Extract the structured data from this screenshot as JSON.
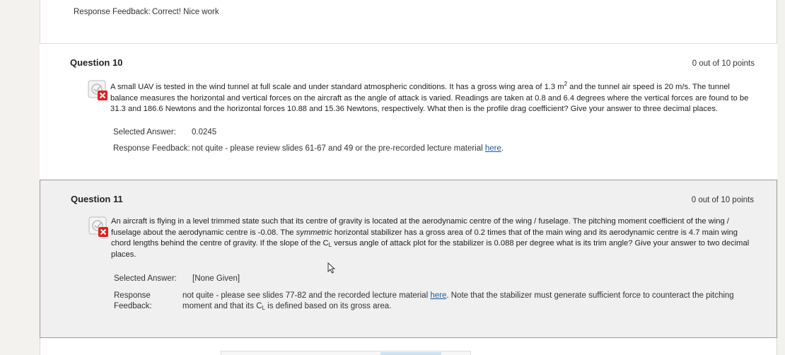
{
  "previous": {
    "feedback_label": "Response Feedback:",
    "feedback_value": "Correct! Nice work"
  },
  "q10": {
    "title": "Question 10",
    "points": "0 out of 10 points",
    "status_icon": "incorrect-icon",
    "text_part1": "A small UAV is tested in the wind tunnel at full scale and under standard atmospheric conditions. It has a gross wing area of 1.3 m",
    "text_sup": "2",
    "text_part2": " and the tunnel air speed is 20 m/s. The tunnel balance measures the horizontal and vertical forces on the aircraft as the angle of attack is varied. Readings are taken at 0.8 and 6.4 degrees where the vertical forces are found to be 31.3 and 186.6 Newtons and the horizontal forces 10.88 and 15.36 Newtons, respectively. What then is the profile drag coefficient? Give your answer to three decimal places.",
    "selected_label": "Selected Answer:",
    "selected_value": "0.0245",
    "feedback_label": "Response Feedback:",
    "feedback_text": "not quite - please review slides 61-67 and 49 or the pre-recorded lecture material ",
    "feedback_link": "here",
    "feedback_end": "."
  },
  "q11": {
    "title": "Question 11",
    "points": "0 out of 10 points",
    "status_icon": "incorrect-icon",
    "text_part1": "An aircraft is flying in a level trimmed state such that its centre of gravity is located at the aerodynamic centre of the wing / fuselage. The pitching moment coefficient of the wing / fuselage about the aerodynamic centre is -0.08. The ",
    "text_italic": "symmetric",
    "text_part2": " horizontal stabilizer has a gross area of 0.2 times that of the main wing and its aerodynamic centre is 4.7 main wing chord lengths behind the centre of gravity. If the slope of the C",
    "text_sub": "L",
    "text_part3": " versus angle of attack plot for the stabilizer is 0.088 per degree what is its trim angle? Give your answer to two decimal places.",
    "selected_label": "Selected Answer:",
    "selected_value": "[None Given]",
    "feedback_label_line1": "Response",
    "feedback_label_line2": "Feedback:",
    "feedback_text1": "not quite - please see slides 77-82 and the recorded lecture material ",
    "feedback_link": "here",
    "feedback_text2": ". Note that the stabilizer must generate sufficient force to counteract the pitching moment and that its C",
    "feedback_sub": "L",
    "feedback_text3": " is defined based on its gross area."
  },
  "colors": {
    "link": "#1f5a99",
    "incorrect_badge": "#e02020",
    "q11_background": "#f0f0f0"
  }
}
